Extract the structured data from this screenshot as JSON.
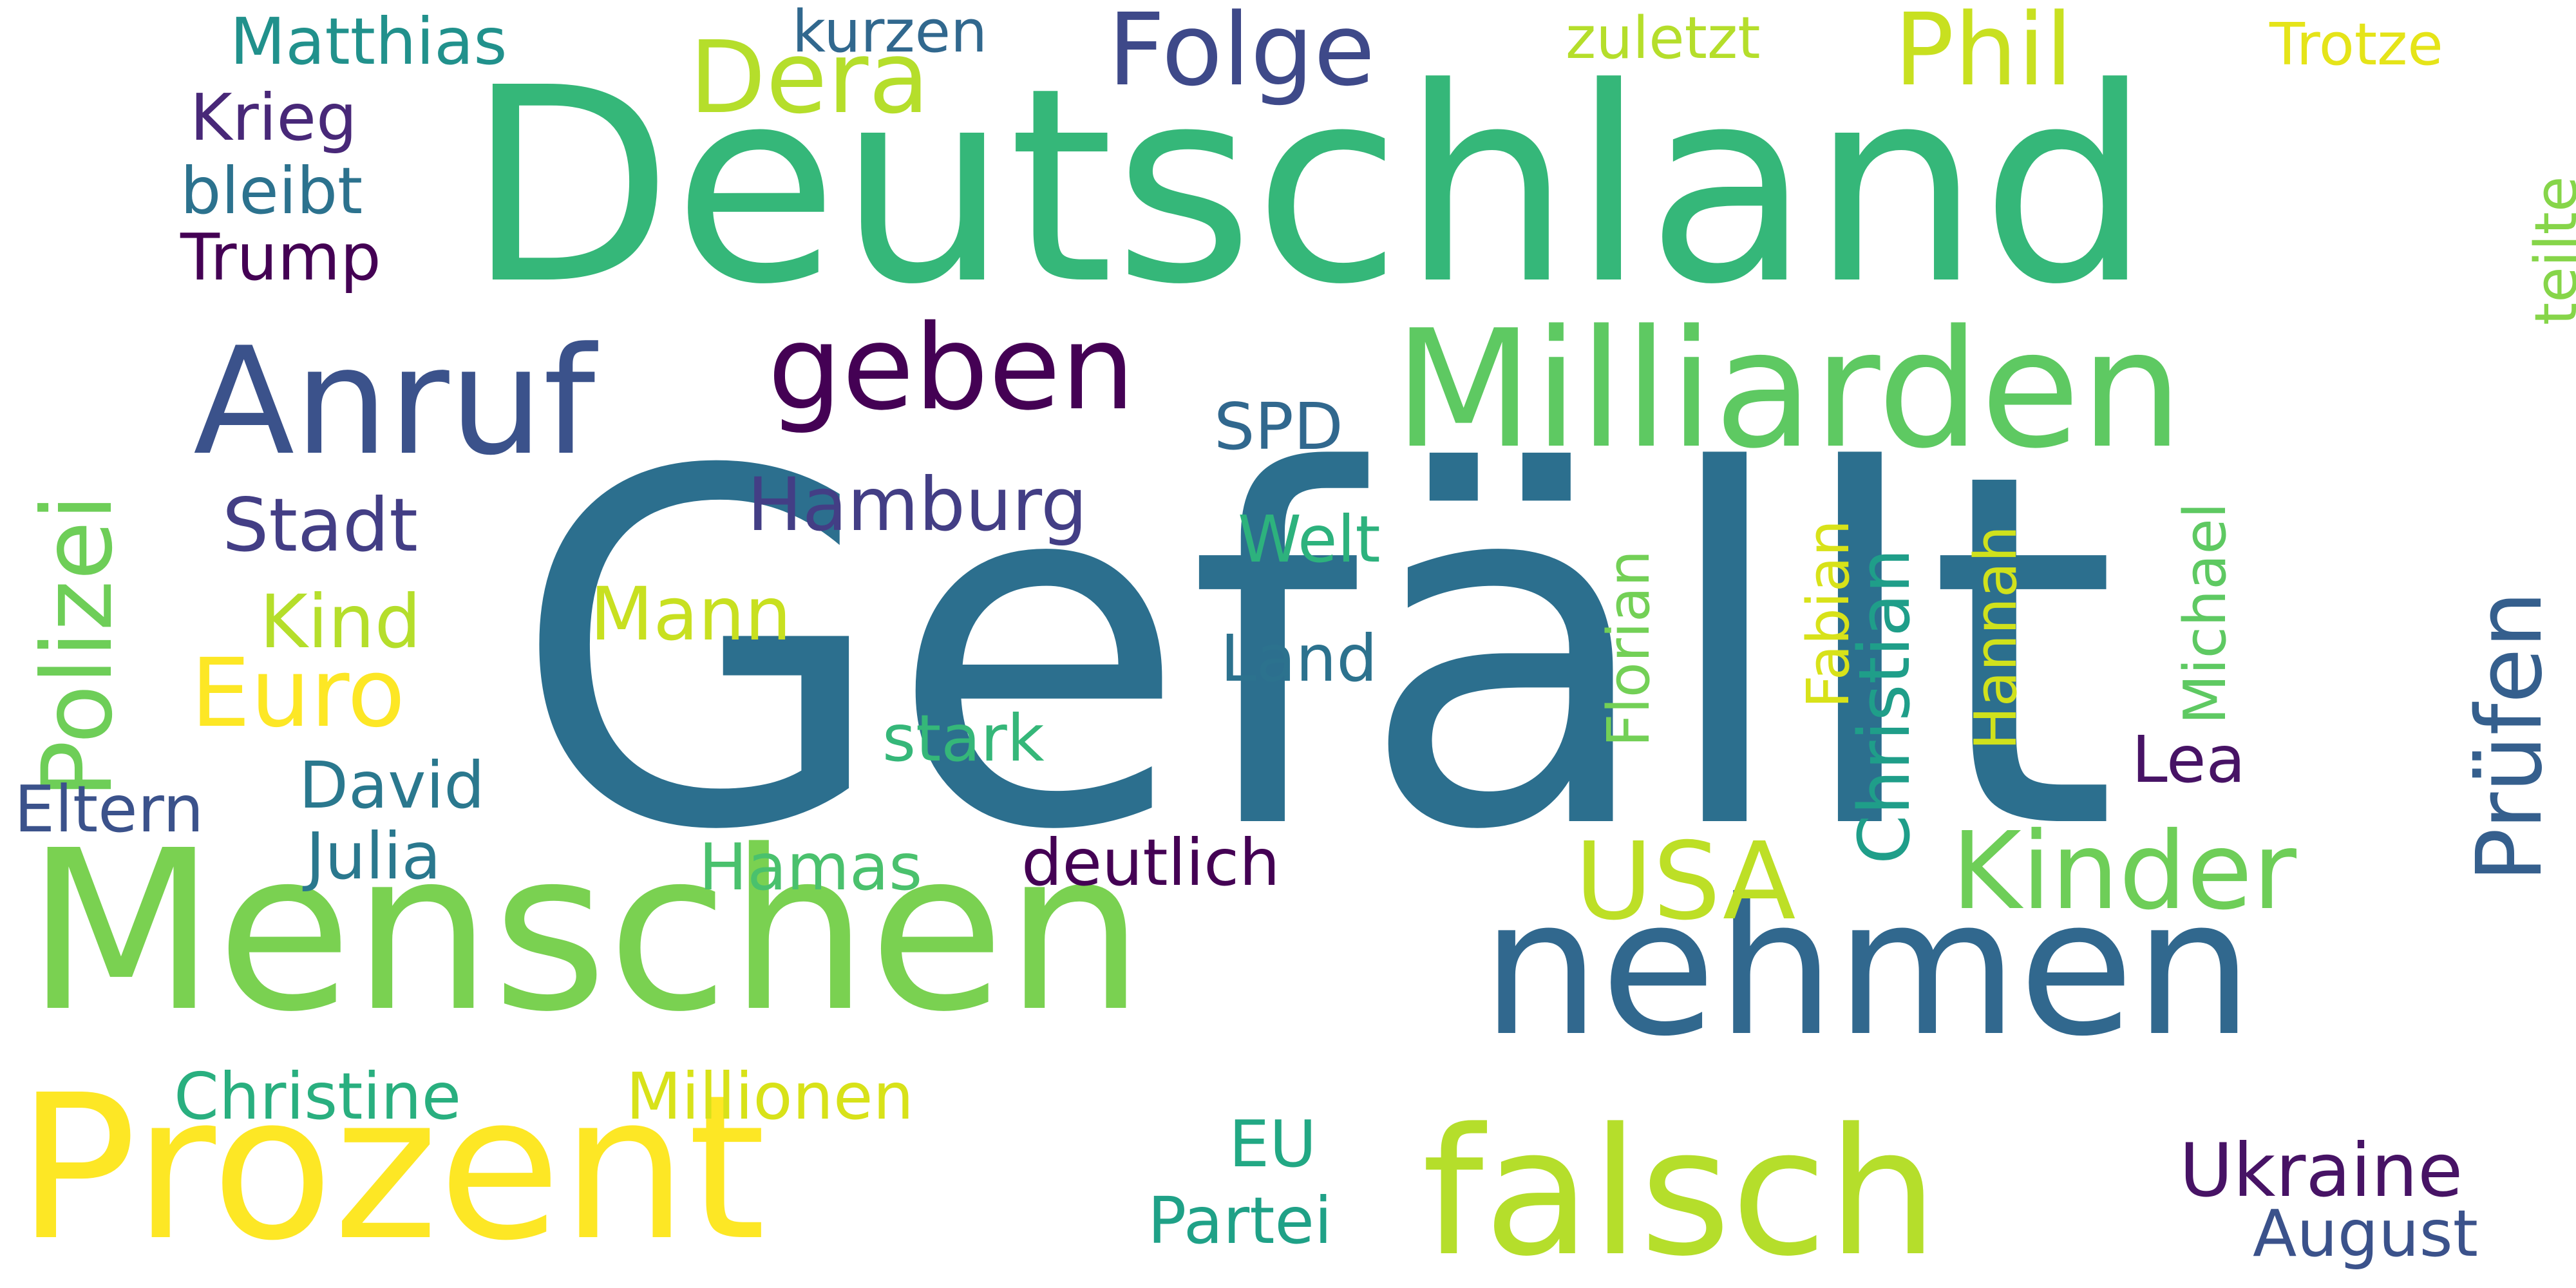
{
  "words": {
    "gefaellt": {
      "text": "Gefällt",
      "color": "#2c6f8e"
    },
    "deutschland": {
      "text": "Deutschland",
      "color": "#35b779"
    },
    "menschen": {
      "text": "Menschen",
      "color": "#7ad151"
    },
    "prozent": {
      "text": "Prozent",
      "color": "#fde725"
    },
    "nehmen": {
      "text": "nehmen",
      "color": "#31688e"
    },
    "falsch": {
      "text": "falsch",
      "color": "#b5de2b"
    },
    "milliarden": {
      "text": "Milliarden",
      "color": "#5ec962"
    },
    "anruf": {
      "text": "Anruf",
      "color": "#3b528b"
    },
    "geben": {
      "text": "geben",
      "color": "#440154"
    },
    "polizei": {
      "text": "Polizei",
      "color": "#6ece58"
    },
    "kinder": {
      "text": "Kinder",
      "color": "#6ece58"
    },
    "usa": {
      "text": "USA",
      "color": "#bddf26"
    },
    "phil": {
      "text": "Phil",
      "color": "#c8e020"
    },
    "dera": {
      "text": "Dera",
      "color": "#b5de2b"
    },
    "folge": {
      "text": "Folge",
      "color": "#3e4989"
    },
    "euro": {
      "text": "Euro",
      "color": "#fde725"
    },
    "pruefen": {
      "text": "Prüfen",
      "color": "#355f8d"
    },
    "christian": {
      "text": "Christian",
      "color": "#1f9e89"
    },
    "hamburg": {
      "text": "Hamburg",
      "color": "#433e85"
    },
    "stadt": {
      "text": "Stadt",
      "color": "#433e85"
    },
    "kind": {
      "text": "Kind",
      "color": "#b5de2b"
    },
    "mann": {
      "text": "Mann",
      "color": "#c8e020"
    },
    "ukraine": {
      "text": "Ukraine",
      "color": "#471365"
    },
    "millionen": {
      "text": "Millionen",
      "color": "#d8e219"
    },
    "christine": {
      "text": "Christine",
      "color": "#29af7f"
    },
    "julia": {
      "text": "Julia",
      "color": "#2a788e"
    },
    "david": {
      "text": "David",
      "color": "#2a788e"
    },
    "matthias": {
      "text": "Matthias",
      "color": "#21918c"
    },
    "trump": {
      "text": "Trump",
      "color": "#440154"
    },
    "august": {
      "text": "August",
      "color": "#3b528b"
    },
    "partei": {
      "text": "Partei",
      "color": "#1fa187"
    },
    "eu": {
      "text": "EU",
      "color": "#22a884"
    },
    "lea": {
      "text": "Lea",
      "color": "#471365"
    },
    "deutlich": {
      "text": "deutlich",
      "color": "#440154"
    },
    "krieg": {
      "text": "Krieg",
      "color": "#482878"
    },
    "bleibt": {
      "text": "bleibt",
      "color": "#2c728e"
    },
    "land": {
      "text": "Land",
      "color": "#2c728e"
    },
    "eltern": {
      "text": "Eltern",
      "color": "#3b528b"
    },
    "spd": {
      "text": "SPD",
      "color": "#31688e"
    },
    "welt": {
      "text": "Welt",
      "color": "#2db27d"
    },
    "stark": {
      "text": "stark",
      "color": "#35b779"
    },
    "hamas": {
      "text": "Hamas",
      "color": "#4ac16d"
    },
    "florian": {
      "text": "Florian",
      "color": "#73d056"
    },
    "fabian": {
      "text": "Fabian",
      "color": "#d8e219"
    },
    "hannah": {
      "text": "Hannah",
      "color": "#d0e11c"
    },
    "michael": {
      "text": "Michael",
      "color": "#5ec962"
    },
    "teilte": {
      "text": "teilte",
      "color": "#86d549"
    },
    "zuletzt": {
      "text": "zuletzt",
      "color": "#b5de2b"
    },
    "kurzen": {
      "text": "kurzen",
      "color": "#31688e"
    },
    "trotze": {
      "text": "Trotze",
      "color": "#e5e419"
    }
  }
}
